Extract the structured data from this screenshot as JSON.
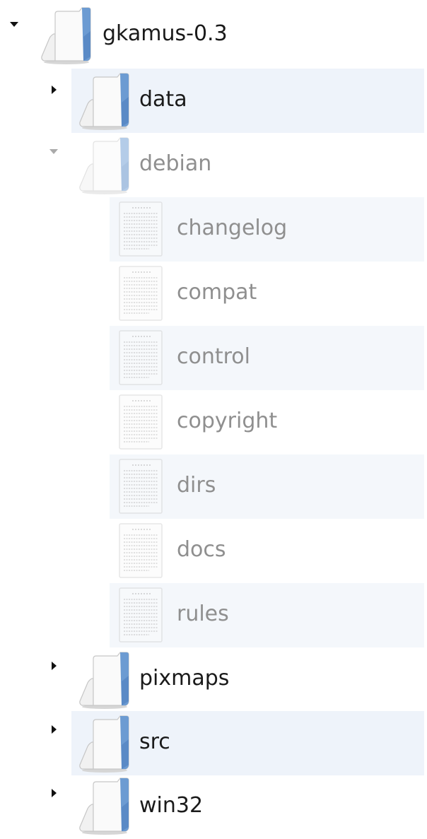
{
  "tree": {
    "root": {
      "label": "gkamus-0.3",
      "expanded": true,
      "icon": "folder-icon"
    },
    "items": [
      {
        "label": "data",
        "expanded": false,
        "icon": "folder-icon"
      },
      {
        "label": "debian",
        "expanded": true,
        "icon": "folder-icon",
        "children": [
          {
            "label": "changelog",
            "icon": "text-file-icon"
          },
          {
            "label": "compat",
            "icon": "text-file-icon"
          },
          {
            "label": "control",
            "icon": "text-file-icon"
          },
          {
            "label": "copyright",
            "icon": "text-file-icon"
          },
          {
            "label": "dirs",
            "icon": "text-file-icon"
          },
          {
            "label": "docs",
            "icon": "text-file-icon"
          },
          {
            "label": "rules",
            "icon": "text-file-icon"
          }
        ]
      },
      {
        "label": "pixmaps",
        "expanded": false,
        "icon": "folder-icon"
      },
      {
        "label": "src",
        "expanded": false,
        "icon": "folder-icon"
      },
      {
        "label": "win32",
        "expanded": false,
        "icon": "folder-icon"
      }
    ]
  },
  "colors": {
    "row_stripe": "#eef3fa",
    "dimmed_text": "#8f8f8f",
    "folder_blue": "#5f8fc9"
  }
}
